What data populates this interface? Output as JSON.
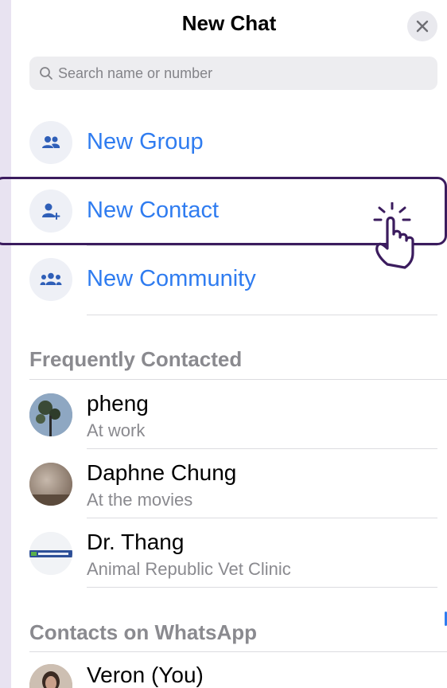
{
  "header": {
    "title": "New Chat",
    "close_icon": "close-icon"
  },
  "search": {
    "placeholder": "Search name or number"
  },
  "actions": [
    {
      "label": "New Group",
      "icon": "group-icon"
    },
    {
      "label": "New Contact",
      "icon": "add-contact-icon"
    },
    {
      "label": "New Community",
      "icon": "community-icon"
    }
  ],
  "sections": {
    "frequent": "Frequently Contacted",
    "whatsapp": "Contacts on WhatsApp"
  },
  "contacts": [
    {
      "name": "pheng",
      "status": "At work"
    },
    {
      "name": "Daphne Chung",
      "status": "At the movies"
    },
    {
      "name": "Dr. Thang",
      "status": "Animal Republic Vet Clinic"
    }
  ],
  "whatsapp_contacts": [
    {
      "name": "Veron (You)"
    }
  ],
  "colors": {
    "accent": "#2f7cf0",
    "highlight": "#3b1c5e",
    "background": "#e8e3f1"
  }
}
